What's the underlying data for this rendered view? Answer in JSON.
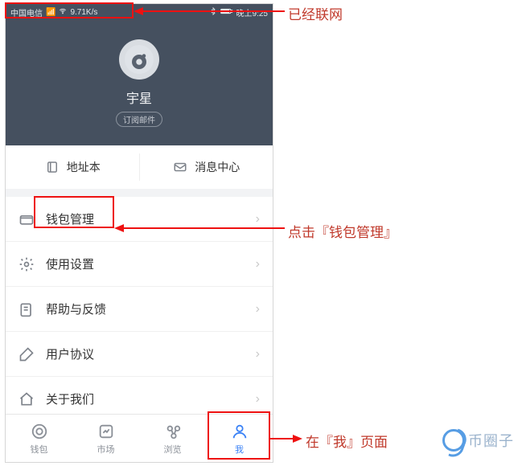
{
  "status": {
    "carrier": "中国电信",
    "speed": "9.71K/s",
    "time": "晚上9:25"
  },
  "profile": {
    "username": "宇星",
    "sub_label": "订阅邮件"
  },
  "quick": {
    "address_book": "地址本",
    "message_center": "消息中心"
  },
  "menu": {
    "items": [
      {
        "label": "钱包管理"
      },
      {
        "label": "使用设置"
      },
      {
        "label": "帮助与反馈"
      },
      {
        "label": "用户协议"
      },
      {
        "label": "关于我们"
      }
    ]
  },
  "nav": {
    "items": [
      {
        "label": "钱包"
      },
      {
        "label": "市场"
      },
      {
        "label": "浏览"
      },
      {
        "label": "我"
      }
    ]
  },
  "annotations": {
    "networked": "已经联网",
    "wallet_manage": "点击『钱包管理』",
    "me_page": "在『我』页面"
  },
  "watermark": "币圈子"
}
